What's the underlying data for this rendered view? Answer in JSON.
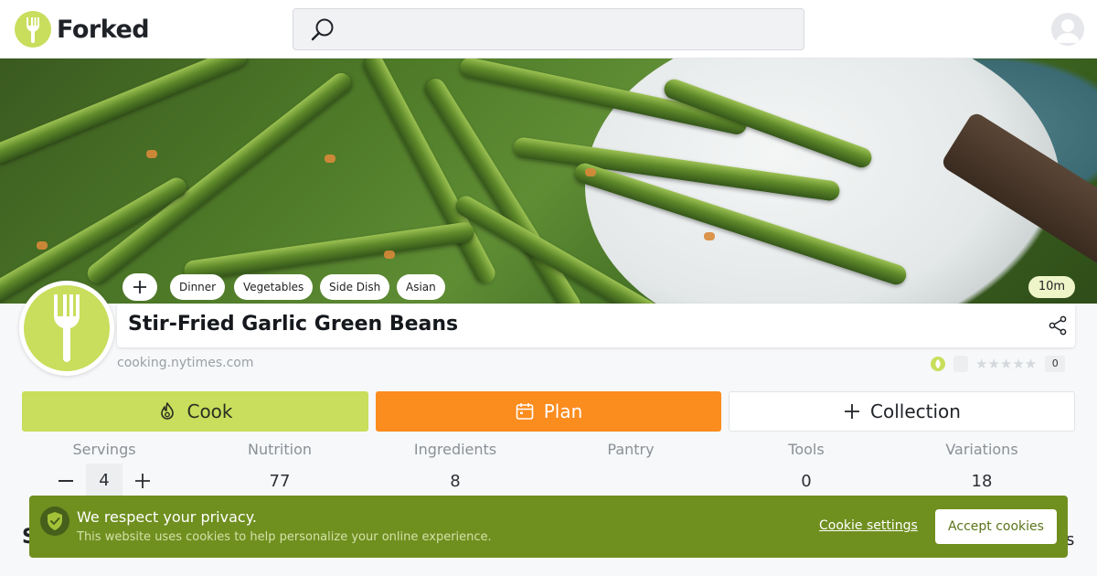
{
  "brand": {
    "name": "Forked",
    "accent": "#c8de5c"
  },
  "search": {
    "placeholder": ""
  },
  "tags": [
    "Dinner",
    "Vegetables",
    "Side Dish",
    "Asian"
  ],
  "time": "10m",
  "recipe": {
    "title": "Stir-Fried Garlic Green Beans",
    "source": "cooking.nytimes.com"
  },
  "rating": {
    "stars": "★★★★★",
    "count": "0"
  },
  "actions": {
    "cook": "Cook",
    "plan": "Plan",
    "collection": "Collection"
  },
  "stats": {
    "servings": {
      "label": "Servings",
      "value": "4"
    },
    "nutrition": {
      "label": "Nutrition",
      "value": "77"
    },
    "ingredients": {
      "label": "Ingredients",
      "value": "8"
    },
    "pantry": {
      "label": "Pantry",
      "value": ""
    },
    "tools": {
      "label": "Tools",
      "value": "0"
    },
    "variations": {
      "label": "Variations",
      "value": "18"
    }
  },
  "below": {
    "left": "S",
    "right": "s"
  },
  "cookie": {
    "title": "We respect your privacy.",
    "text": "This website uses cookies to help personalize your online experience.",
    "settings": "Cookie settings",
    "accept": "Accept cookies"
  }
}
